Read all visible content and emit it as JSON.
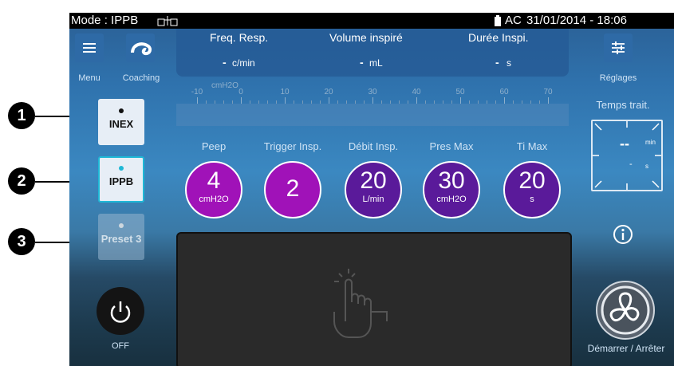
{
  "status": {
    "mode_label": "Mode : IPPB",
    "power_source": "AC",
    "datetime": "31/01/2014 - 18:06"
  },
  "left_nav": {
    "menu_label": "Menu",
    "coaching_label": "Coaching"
  },
  "params": {
    "freq": {
      "title": "Freq. Resp.",
      "value": "-",
      "unit": "c/min"
    },
    "volume": {
      "title": "Volume inspiré",
      "value": "-",
      "unit": "mL"
    },
    "duree": {
      "title": "Durée Inspi.",
      "value": "-",
      "unit": "s"
    }
  },
  "gauge": {
    "unit": "cmH2O",
    "ticks": [
      "-10",
      "0",
      "10",
      "20",
      "30",
      "40",
      "50",
      "60",
      "70"
    ]
  },
  "settings": [
    {
      "label": "Peep",
      "value": "4",
      "unit": "cmH2O",
      "color": "#a012b8"
    },
    {
      "label": "Trigger Insp.",
      "value": "2",
      "unit": "",
      "color": "#a012b8"
    },
    {
      "label": "Débit Insp.",
      "value": "20",
      "unit": "L/min",
      "color": "#5a1a9a"
    },
    {
      "label": "Pres Max",
      "value": "30",
      "unit": "cmH2O",
      "color": "#5a1a9a"
    },
    {
      "label": "Ti Max",
      "value": "20",
      "unit": "s",
      "color": "#5a1a9a"
    }
  ],
  "modes": [
    {
      "label": "INEX",
      "state": "normal"
    },
    {
      "label": "IPPB",
      "state": "active"
    },
    {
      "label": "Preset 3",
      "state": "disabled"
    }
  ],
  "callouts": [
    "1",
    "2",
    "3"
  ],
  "power": {
    "label": "OFF"
  },
  "right_nav": {
    "settings_label": "Réglages",
    "timer_title": "Temps trait.",
    "timer_value": "--",
    "timer_unit_min": "min",
    "timer_value_s": "-",
    "timer_unit_s": "s"
  },
  "start_stop": {
    "label": "Démarrer / Arrêter"
  },
  "colors": {
    "accent": "#1fb8d6",
    "panel": "#2b2b2b"
  }
}
